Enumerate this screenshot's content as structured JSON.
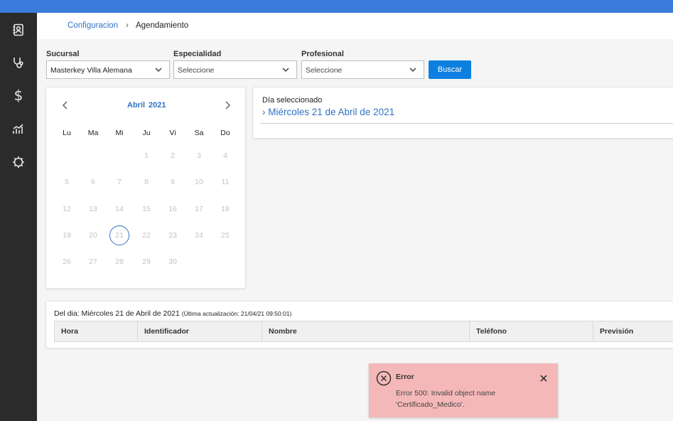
{
  "colors": {
    "topbar": "#3b7bdb",
    "sidebar": "#2b2b2b",
    "accent": "#2f72c4",
    "button": "#0d7fe0",
    "toast_bg": "#f5b8b9"
  },
  "sidebar": {
    "icons": [
      "contacts-icon",
      "stethoscope-icon",
      "dollar-icon",
      "chart-icon",
      "gear-icon"
    ],
    "dollar_glyph": "$"
  },
  "breadcrumb": {
    "parent": "Configuracion",
    "separator": "›",
    "current": "Agendamiento"
  },
  "filters": {
    "sucursal_label": "Sucursal",
    "sucursal_value": "Masterkey Villa Alemana",
    "especialidad_label": "Especialidad",
    "especialidad_value": "Seleccione",
    "profesional_label": "Profesional",
    "profesional_value": "Seleccione",
    "search_button": "Buscar"
  },
  "calendar": {
    "month": "Abril",
    "year": "2021",
    "weekdays": [
      "Lu",
      "Ma",
      "Mi",
      "Ju",
      "Vi",
      "Sa",
      "Do"
    ],
    "first_weekday_index": 3,
    "days_in_month": 30,
    "selected_day": 21
  },
  "selected_day_panel": {
    "label": "Día seleccionado",
    "date": "› Miércoles 21 de Abril de 2021"
  },
  "schedule_table": {
    "title": "Del dia: Miércoles 21 de Abril de 2021",
    "updated": "(Última actualización: 21/04/21 09:50:01)",
    "columns": [
      "Hora",
      "Identificador",
      "Nombre",
      "Teléfono",
      "Previsión"
    ],
    "rows": []
  },
  "toast": {
    "title": "Error",
    "message": "Error 500: Invalid object name 'Certificado_Medico'."
  }
}
